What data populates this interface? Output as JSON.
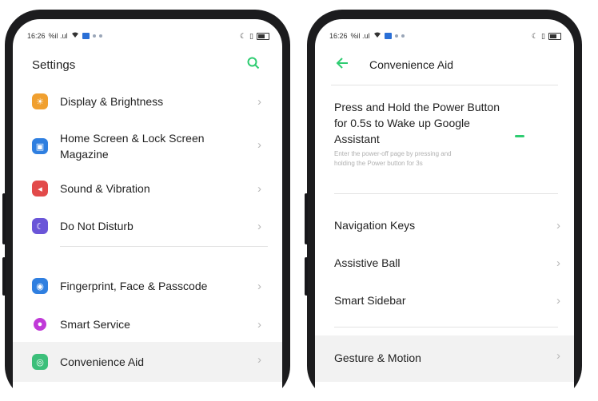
{
  "left": {
    "status": {
      "time": "16:26",
      "carrier": "%il .ul"
    },
    "title": "Settings",
    "items": [
      {
        "label": "Display & Brightness",
        "icon": "display-icon",
        "color": "#f0a030"
      },
      {
        "label": "Home Screen & Lock Screen",
        "label2": "Magazine",
        "icon": "home-screen-icon",
        "color": "#2f7fe0"
      },
      {
        "label": "Sound & Vibration",
        "icon": "sound-icon",
        "color": "#e24a4a"
      },
      {
        "label": "Do Not Disturb",
        "icon": "moon-icon",
        "color": "#6a55d8"
      },
      {
        "label": "Fingerprint, Face & Passcode",
        "icon": "fingerprint-icon",
        "color": "#2f7fe0"
      },
      {
        "label": "Smart Service",
        "icon": "smart-service-icon",
        "color": "#c03ad8"
      },
      {
        "label": "Convenience Aid",
        "icon": "convenience-aid-icon",
        "color": "#3cbf7a"
      }
    ]
  },
  "right": {
    "status": {
      "time": "16:26",
      "carrier": "%il .ul"
    },
    "title": "Convenience Aid",
    "power_option": {
      "line1": "Press and Hold the Power Button",
      "line2": "for 0.5s to Wake up Google",
      "line3": "Assistant",
      "desc1": "Enter the power-off page by pressing and",
      "desc2": "holding the Power button for 3s"
    },
    "items": [
      {
        "label": "Navigation Keys"
      },
      {
        "label": "Assistive Ball"
      },
      {
        "label": "Smart Sidebar"
      },
      {
        "label": "Gesture & Motion"
      }
    ]
  },
  "colors": {
    "accent": "#2ecc71",
    "text": "#222222",
    "divider": "#e3e3e3"
  }
}
